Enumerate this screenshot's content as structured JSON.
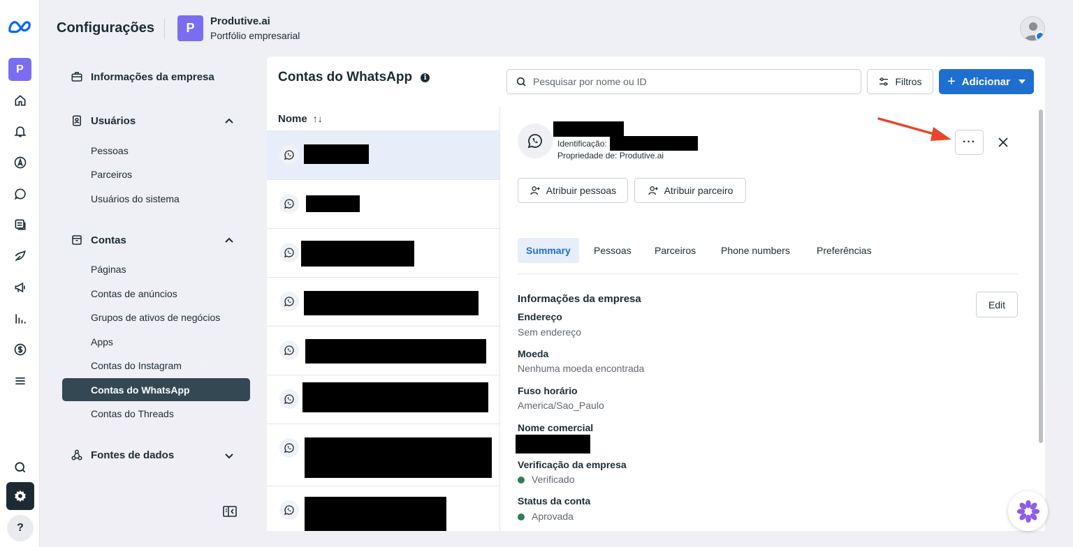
{
  "header": {
    "title": "Configurações",
    "business_initial": "P",
    "business_name": "Produtive.ai",
    "business_subtitle": "Portfólio empresarial"
  },
  "rail": {
    "business_initial": "P",
    "help_label": "?"
  },
  "sidebar": {
    "company_info": "Informações da empresa",
    "users": {
      "label": "Usuários",
      "items": [
        "Pessoas",
        "Parceiros",
        "Usuários do sistema"
      ]
    },
    "accounts": {
      "label": "Contas",
      "items": [
        "Páginas",
        "Contas de anúncios",
        "Grupos de ativos de negócios",
        "Apps",
        "Contas do Instagram",
        "Contas do WhatsApp",
        "Contas do Threads"
      ],
      "active": "Contas do WhatsApp"
    },
    "data_sources": "Fontes de dados"
  },
  "main": {
    "title": "Contas do WhatsApp",
    "search_placeholder": "Pesquisar por nome ou ID",
    "filter_label": "Filtros",
    "add_label": "Adicionar",
    "list_header": "Nome",
    "sort_icon": "↑↓"
  },
  "detail": {
    "id_label": "Identificação:",
    "owner_label": "Propriedade de: Produtive.ai",
    "more_label": "···",
    "assign_people": "Atribuir pessoas",
    "assign_partner": "Atribuir parceiro",
    "tabs": [
      "Summary",
      "Pessoas",
      "Parceiros",
      "Phone numbers",
      "Preferências"
    ],
    "active_tab": "Summary",
    "section_title": "Informações da empresa",
    "edit_label": "Edit",
    "fields": {
      "address_label": "Endereço",
      "address_value": "Sem endereço",
      "currency_label": "Moeda",
      "currency_value": "Nenhuma moeda encontrada",
      "timezone_label": "Fuso horário",
      "timezone_value": "America/Sao_Paulo",
      "trade_name_label": "Nome comercial",
      "verification_label": "Verificação da empresa",
      "verification_value": "Verificado",
      "account_status_label": "Status da conta",
      "account_status_value": "Aprovada"
    }
  },
  "colors": {
    "accent": "#1f6fd1",
    "brand_purple": "#7b6df1",
    "status_green": "#2f7d57",
    "annotation_red": "#e8452c"
  }
}
